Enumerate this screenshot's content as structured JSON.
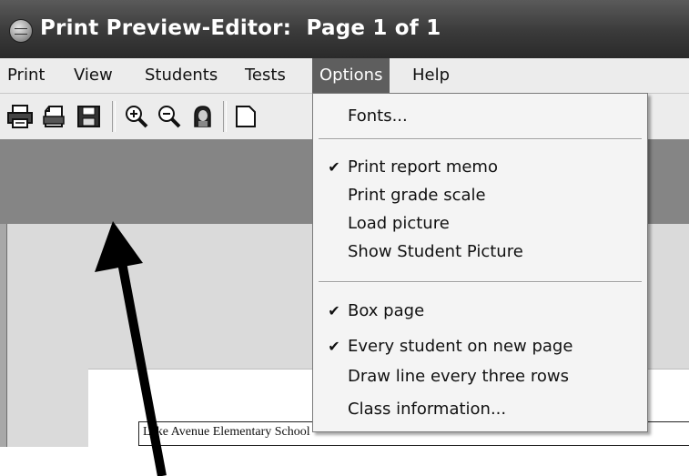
{
  "window": {
    "title": "Print Preview-Editor:  Page 1 of 1",
    "icon": "printer-app-icon"
  },
  "menubar": {
    "items": [
      {
        "label": "Print"
      },
      {
        "label": "View"
      },
      {
        "label": "Students"
      },
      {
        "label": "Tests"
      },
      {
        "label": "Options",
        "active": true
      },
      {
        "label": "Help"
      }
    ]
  },
  "toolbar": {
    "buttons": [
      {
        "icon": "printer-icon"
      },
      {
        "icon": "print-setup-icon"
      },
      {
        "icon": "save-disk-icon"
      },
      {
        "icon": "zoom-in-icon"
      },
      {
        "icon": "zoom-out-icon"
      },
      {
        "icon": "student-picture-icon"
      },
      {
        "icon": "page-icon"
      }
    ]
  },
  "options_menu": {
    "groups": [
      [
        {
          "label": "Fonts...",
          "checked": false
        }
      ],
      [
        {
          "label": "Print report memo",
          "checked": true
        },
        {
          "label": "Print grade scale",
          "checked": false
        },
        {
          "label": "Load picture",
          "checked": false
        },
        {
          "label": "Show Student Picture",
          "checked": false
        }
      ],
      [
        {
          "label": "Box page",
          "checked": true
        },
        {
          "label": "Every student on new page",
          "checked": true
        },
        {
          "label": "Draw line every three rows",
          "checked": false
        },
        {
          "label": "Class information...",
          "checked": false
        }
      ]
    ],
    "check_glyph": "✔"
  },
  "preview": {
    "school_name": "Lake Avenue Elementary School"
  },
  "colors": {
    "title_bg": "#3a3a3a",
    "menu_highlight": "#5e5e5e",
    "annotation_arrow": "#000000"
  }
}
